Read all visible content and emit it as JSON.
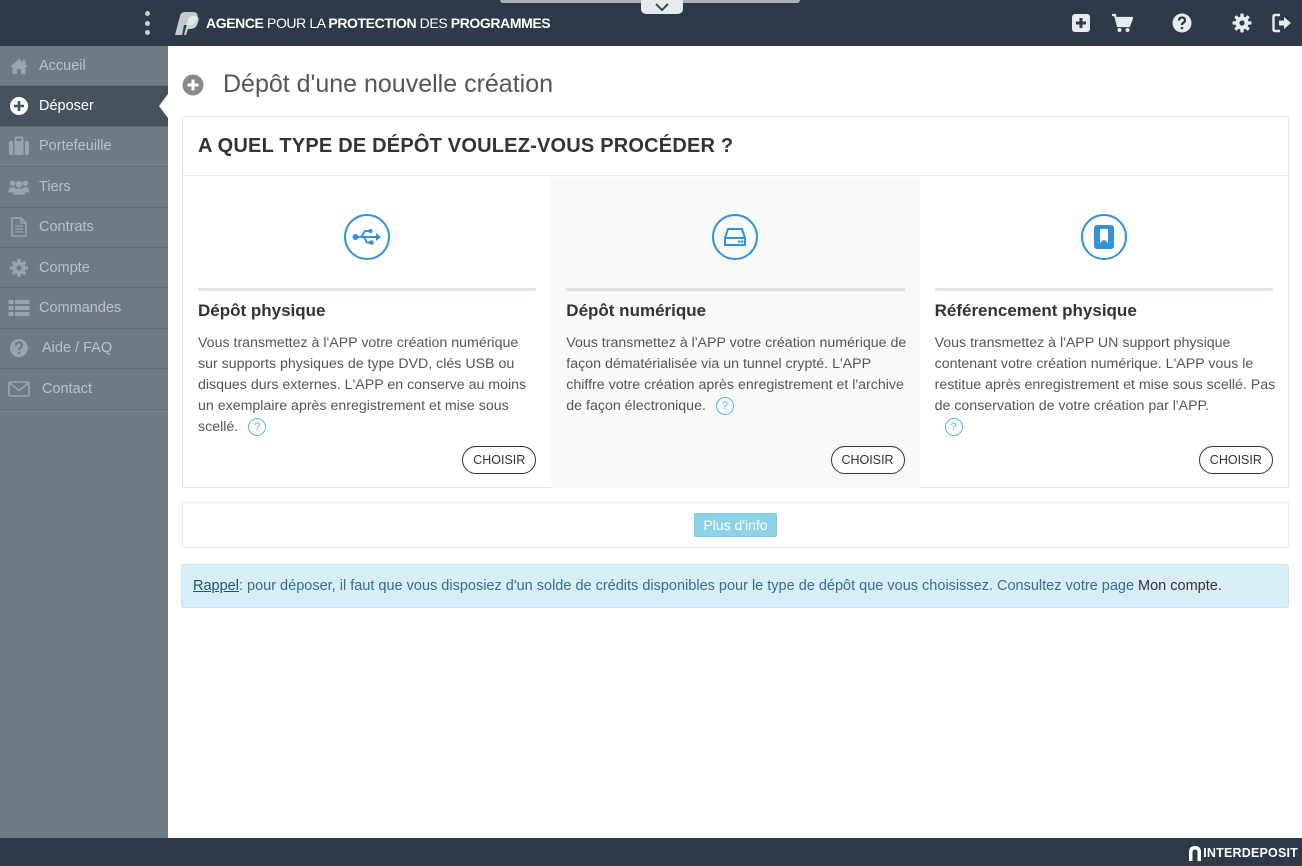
{
  "header": {
    "logo_strong_1": "AGENCE",
    "logo_thin_1": "POUR LA",
    "logo_strong_2": "PROTECTION",
    "logo_thin_2": "DES",
    "logo_strong_3": "PROGRAMMES",
    "icons": [
      "add-icon",
      "cart-icon",
      "help-icon",
      "settings-icon",
      "logout-icon"
    ]
  },
  "sidebar": {
    "items": [
      {
        "label": "Accueil",
        "icon": "home-icon"
      },
      {
        "label": "Déposer",
        "icon": "plus-circle-icon",
        "active": true
      },
      {
        "label": "Portefeuille",
        "icon": "briefcase-icon"
      },
      {
        "label": "Tiers",
        "icon": "users-icon"
      },
      {
        "label": "Contrats",
        "icon": "document-icon"
      },
      {
        "label": "Compte",
        "icon": "gear-icon"
      },
      {
        "label": "Commandes",
        "icon": "list-icon"
      },
      {
        "label": "Aide / FAQ",
        "icon": "question-icon"
      },
      {
        "label": "Contact",
        "icon": "envelope-icon"
      }
    ]
  },
  "page": {
    "title": "Dépôt d'une nouvelle création",
    "panel_heading": "A QUEL TYPE DE DÉPÔT VOULEZ-VOUS PROCÉDER ?",
    "options": [
      {
        "title": "Dépôt physique",
        "text": "Vous transmettez à l'APP votre création numérique sur supports physiques de type DVD, clés USB ou disques durs externes. L'APP en conserve au moins un exemplaire après enregistrement et mise sous scellé.",
        "button": "CHOISIR",
        "icon": "usb-icon"
      },
      {
        "title": "Dépôt numérique",
        "text": "Vous transmettez à l'APP votre création numérique de façon dématérialisée via un tunnel crypté. L'APP chiffre votre création après enregistrement et l'archive de façon électronique.",
        "button": "CHOISIR",
        "icon": "hard-drive-icon"
      },
      {
        "title": "Référencement physique",
        "text": "Vous transmettez à l'APP UN support physique contenant votre création numérique. L'APP vous le restitue après enregistrement et mise sous scellé. Pas de conservation de votre création par l'APP.",
        "button": "CHOISIR",
        "icon": "bookmark-icon"
      }
    ],
    "help_glyph": "?",
    "more_info": "Plus d'info",
    "reminder": {
      "link": "Rappel",
      "text": " : pour déposer, il faut que vous disposiez d'un solde de crédits disponibles pour le type de dépôt que vous choisissez. Consultez votre page",
      "account": "Mon compte."
    }
  },
  "footer": {
    "brand": "INTERDEPOSIT"
  },
  "colors": {
    "topbar": "#2e3a47",
    "sidebar": "#6e7a86",
    "sidebar_active": "#46525e",
    "accent": "#3592d9",
    "info_bg": "#d9edf7"
  }
}
